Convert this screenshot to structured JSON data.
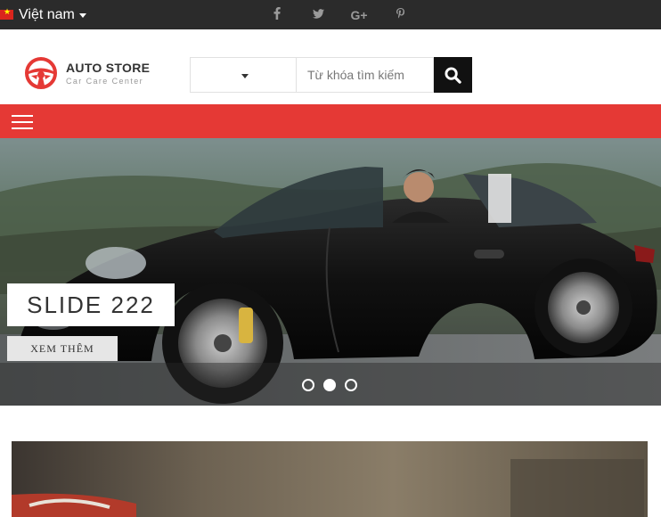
{
  "topbar": {
    "language": "Việt nam",
    "social": [
      {
        "icon": "facebook-icon",
        "glyph": "f"
      },
      {
        "icon": "twitter-icon",
        "glyph": "🐦"
      },
      {
        "icon": "google-plus-icon",
        "glyph": "G+"
      },
      {
        "icon": "pinterest-icon",
        "glyph": "𝒑"
      }
    ]
  },
  "header": {
    "logo_title": "AUTO STORE",
    "logo_subtitle": "Car Care Center",
    "search_placeholder": "Từ khóa tìm kiếm"
  },
  "slider": {
    "slide_title": "SLIDE 222",
    "button_label": "XEM THÊM",
    "slide_count": 3,
    "active_slide": 2
  },
  "colors": {
    "topbar": "#2b2b2b",
    "nav": "#e53935",
    "logo_accent": "#e53935",
    "search_button": "#111111"
  }
}
